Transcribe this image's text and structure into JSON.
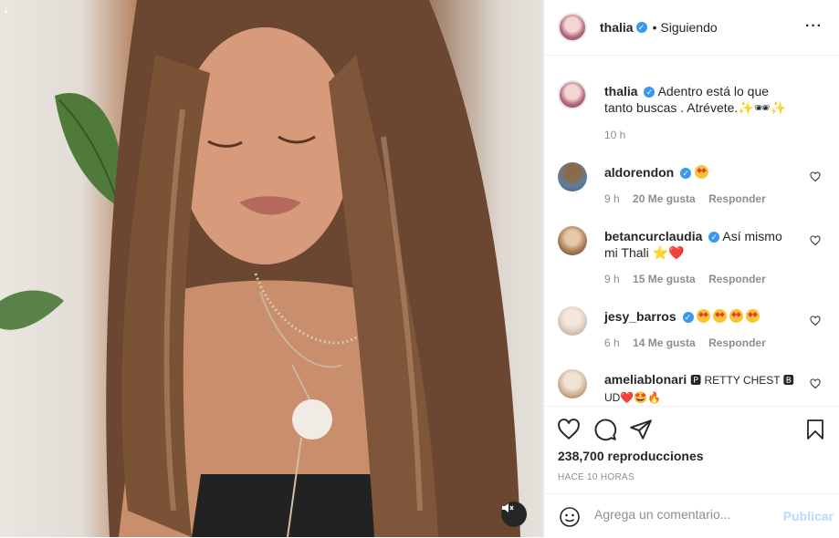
{
  "post": {
    "author": "thalia",
    "follow_status": "• Siguiendo",
    "more_icon": "more-horizontal-icon"
  },
  "caption": {
    "username": "thalia",
    "text": "Adentro está lo que tanto buscas . Atrévete.✨🕶✨",
    "time": "10 h"
  },
  "comments": [
    {
      "username": "aldorendon",
      "text": "🤩",
      "time": "9 h",
      "likes": "20 Me gusta",
      "reply": "Responder"
    },
    {
      "username": "betancurclaudia",
      "text": "Así mismo mi Thali ⭐❤️",
      "time": "9 h",
      "likes": "15 Me gusta",
      "reply": "Responder"
    },
    {
      "username": "jesy_barros",
      "text": "🤩🤩🤩🤩",
      "time": "6 h",
      "likes": "14 Me gusta",
      "reply": "Responder"
    },
    {
      "username": "ameliablonari",
      "text": "🅿 RETTY CHEST 🅱 UD❤️🤩🔥",
      "time": "",
      "likes": "",
      "reply": ""
    }
  ],
  "stats": {
    "views": "238,700 reproducciones",
    "ago": "HACE 10 HORAS"
  },
  "add_comment": {
    "placeholder": "Agrega un comentario...",
    "publish": "Publicar"
  },
  "colors": {
    "verified": "#3897f0",
    "publish": "#b3dbff",
    "muted_text": "#8e8e8e"
  }
}
